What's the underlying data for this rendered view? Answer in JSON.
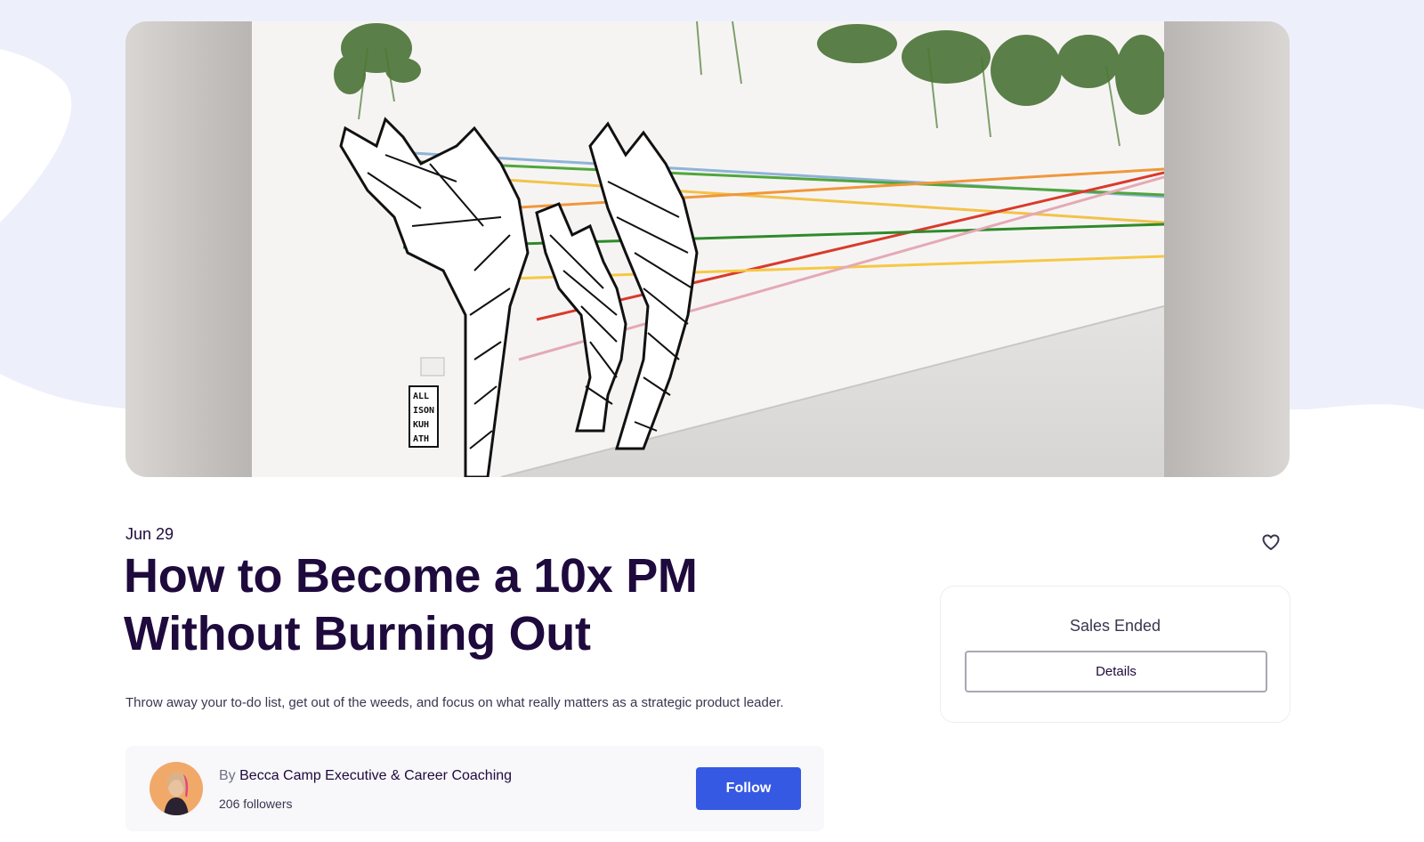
{
  "event": {
    "date": "Jun 29",
    "title": "How to Become a 10x PM Without Burning Out",
    "summary": "Throw away your to-do list, get out of the weeds, and focus on what really matters as a strategic product leader."
  },
  "organizer": {
    "by_label": "By",
    "name": "Becca Camp Executive & Career Coaching",
    "followers": "206 followers",
    "follow_label": "Follow"
  },
  "sales": {
    "status": "Sales Ended",
    "details_label": "Details"
  },
  "hero_image": {
    "signature_text": [
      "ALL",
      "ISON",
      "KUH",
      "ATH"
    ]
  },
  "colors": {
    "background_blob": "#edf0fb",
    "title": "#1e0a3c",
    "follow_button": "#3659e3",
    "organizer_card": "#f8f7fa"
  },
  "icons": {
    "like": "heart-icon"
  }
}
